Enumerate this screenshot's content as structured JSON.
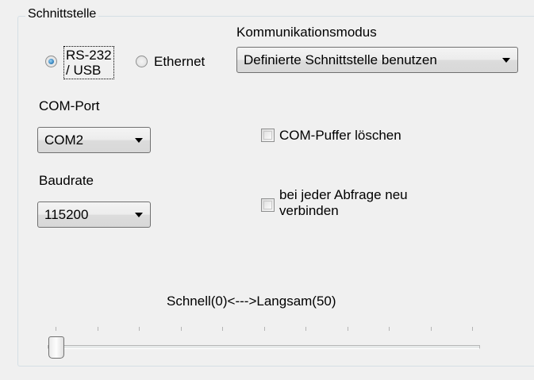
{
  "group": {
    "title": "Schnittstelle"
  },
  "interface": {
    "options": [
      {
        "label_line1": "RS-232",
        "label_line2": "/ USB",
        "selected": true
      },
      {
        "label": "Ethernet",
        "selected": false
      }
    ]
  },
  "comm_mode": {
    "label": "Kommunikationsmodus",
    "value": "Definierte Schnittstelle benutzen"
  },
  "com_port": {
    "label": "COM-Port",
    "value": "COM2"
  },
  "baudrate": {
    "label": "Baudrate",
    "value": "115200"
  },
  "options": {
    "clear_buffer": {
      "label": "COM-Puffer löschen",
      "checked": false
    },
    "reconnect": {
      "label_line1": "bei jeder Abfrage neu",
      "label_line2": "verbinden",
      "checked": false
    }
  },
  "speed": {
    "label": "Schnell(0)<--->Langsam(50)",
    "value": 0,
    "min": 0,
    "max": 50
  },
  "colors": {
    "window_bg": "#f0f0f0",
    "radio_accent": "#2a79b5"
  },
  "icons": {
    "dropdown": "chevron-down-icon"
  }
}
